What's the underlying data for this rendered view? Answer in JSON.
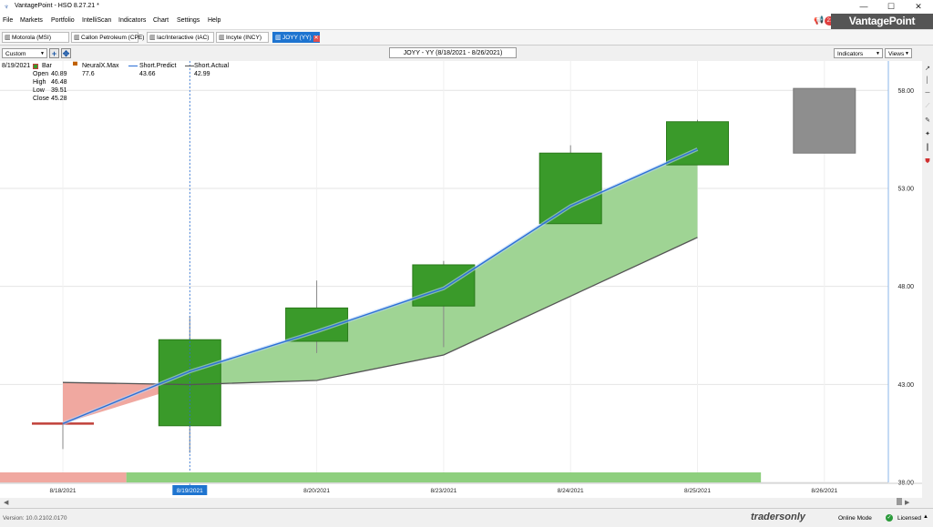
{
  "window": {
    "title": "VantagePoint - HSO 8.27.21 *",
    "minimize": "—",
    "maximize": "☐",
    "close": "✕"
  },
  "menu": [
    "File",
    "Markets",
    "Portfolio",
    "IntelliScan",
    "Indicators",
    "Chart",
    "Settings",
    "Help"
  ],
  "brand": "VantagePoint",
  "notifications": "21",
  "tabs": [
    {
      "label": "Motorola (MSI)"
    },
    {
      "label": "Callon Petroleum (CPE)"
    },
    {
      "label": "Iac/Interactive (IAC)"
    },
    {
      "label": "Incyte (INCY)"
    },
    {
      "label": "JOYY (YY)"
    }
  ],
  "toolbar": {
    "layout": "Custom",
    "chart_title": "JOYY - YY (8/18/2021 - 8/26/2021)",
    "indicators": "Indicators",
    "views": "Views"
  },
  "legend": {
    "date": "8/19/2021",
    "bar_label": "Bar",
    "open_label": "Open",
    "open": "40.89",
    "high_label": "High",
    "high": "46.48",
    "low_label": "Low",
    "low": "39.51",
    "close_label": "Close",
    "close": "45.28",
    "neural_label": "NeuralX.Max",
    "neural": "77.6",
    "predict_label": "Short.Predict",
    "predict": "43.66",
    "actual_label": "Short.Actual",
    "actual": "42.99"
  },
  "chart_data": {
    "type": "bar",
    "dates": [
      "8/18/2021",
      "8/19/2021",
      "8/20/2021",
      "8/23/2021",
      "8/24/2021",
      "8/25/2021",
      "8/26/2021"
    ],
    "selected_date": "8/19/2021",
    "ohlc": [
      {
        "open": 41.0,
        "high": 41.0,
        "low": 41.0,
        "close": 41.0
      },
      {
        "open": 40.89,
        "high": 46.48,
        "low": 39.51,
        "close": 45.28
      },
      {
        "open": 45.2,
        "high": 48.3,
        "low": 44.6,
        "close": 46.9
      },
      {
        "open": 47.0,
        "high": 49.3,
        "low": 44.9,
        "close": 49.1
      },
      {
        "open": 51.2,
        "high": 55.2,
        "low": 51.2,
        "close": 54.8
      },
      {
        "open": 54.2,
        "high": 56.5,
        "low": 54.2,
        "close": 56.4
      },
      {
        "open": 54.8,
        "high": 58.1,
        "low": 54.8,
        "close": 58.1
      }
    ],
    "short_predict": [
      41.0,
      43.66,
      45.7,
      47.9,
      52.1,
      55.0,
      null
    ],
    "short_actual": [
      43.1,
      42.99,
      43.2,
      44.5,
      47.5,
      50.5,
      null
    ],
    "yticks": [
      "38.00",
      "43.00",
      "48.00",
      "53.00",
      "58.00"
    ],
    "ylim": [
      38.0,
      59.5
    ],
    "colors": {
      "up": "#3a9a2a",
      "up_border": "#2a7a1a",
      "forecast": "#8e8e8e",
      "predict": "#2a6fd6",
      "actual": "#555555",
      "fill_bull": "#9fd494",
      "fill_bear": "#f0a8a0",
      "strength_bear": "#f0a8a0",
      "strength_bull": "#8ecf7e"
    }
  },
  "status": {
    "version": "Version: 10.0.2102.0170",
    "mode": "Online Mode",
    "license": "Licensed",
    "logo": "tradersonly"
  }
}
